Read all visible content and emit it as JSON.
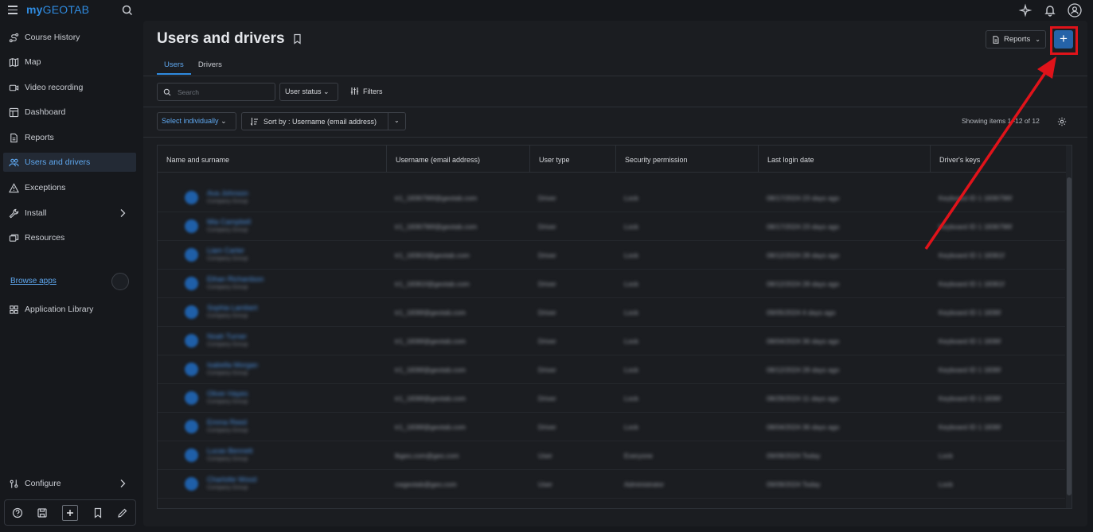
{
  "logo": {
    "part1": "my",
    "part2": "GEOTAB"
  },
  "sidebar": {
    "items": [
      {
        "label": "Course History",
        "icon": "route-icon"
      },
      {
        "label": "Map",
        "icon": "map-icon"
      },
      {
        "label": "Video recording",
        "icon": "video-icon"
      },
      {
        "label": "Dashboard",
        "icon": "dashboard-icon"
      },
      {
        "label": "Reports",
        "icon": "report-icon"
      },
      {
        "label": "Users and drivers",
        "icon": "users-icon",
        "active": true
      },
      {
        "label": "Exceptions",
        "icon": "warning-icon"
      },
      {
        "label": "Install",
        "icon": "wrench-icon"
      },
      {
        "label": "Resources",
        "icon": "resources-icon"
      }
    ],
    "browse_apps": "Browse apps",
    "app_library": "Application Library",
    "configure": "Configure"
  },
  "header": {
    "title": "Users and drivers",
    "reports_label": "Reports",
    "add_label": "+"
  },
  "tabs": [
    {
      "label": "Users",
      "active": true
    },
    {
      "label": "Drivers"
    }
  ],
  "toolbar": {
    "search_placeholder": "Search",
    "user_status": "User status",
    "filters": "Filters",
    "select_individually": "Select individually",
    "sort_by": "Sort by : Username (email address)",
    "showing": "Showing items 1–12 of 12"
  },
  "table": {
    "columns": [
      "Name and surname",
      "Username (email address)",
      "User type",
      "Security permission",
      "Last login date",
      "Driver's keys"
    ],
    "rows": [
      {
        "name": "Ava Johnson",
        "sub": "Company Group",
        "email": "tr1_1836796f@geotab.com",
        "type": "Driver",
        "perm": "Lock",
        "login": "08/17/2024 23 days ago",
        "keys": "Keyboard ID 1 1836796f"
      },
      {
        "name": "Mia Campbell",
        "sub": "Company Group",
        "email": "tr1_1836796f@geotab.com",
        "type": "Driver",
        "perm": "Lock",
        "login": "08/17/2024 23 days ago",
        "keys": "Keyboard ID 1 1836796f"
      },
      {
        "name": "Liam Carter",
        "sub": "Company Group",
        "email": "tr1_18361f@geotab.com",
        "type": "Driver",
        "perm": "Lock",
        "login": "08/12/2024 28 days ago",
        "keys": "Keyboard ID 1 18361f"
      },
      {
        "name": "Ethan Richardson",
        "sub": "Company Group",
        "email": "tr1_18361f@geotab.com",
        "type": "Driver",
        "perm": "Lock",
        "login": "08/12/2024 28 days ago",
        "keys": "Keyboard ID 1 18361f"
      },
      {
        "name": "Sophia Lambert",
        "sub": "Company Group",
        "email": "tr1_1836f@geotab.com",
        "type": "Driver",
        "perm": "Lock",
        "login": "09/05/2024 4 days ago",
        "keys": "Keyboard ID 1 1836f"
      },
      {
        "name": "Noah Turner",
        "sub": "Company Group",
        "email": "tr1_1836f@geotab.com",
        "type": "Driver",
        "perm": "Lock",
        "login": "08/04/2024 36 days ago",
        "keys": "Keyboard ID 1 1836f"
      },
      {
        "name": "Isabella Morgan",
        "sub": "Company Group",
        "email": "tr1_1836f@geotab.com",
        "type": "Driver",
        "perm": "Lock",
        "login": "08/12/2024 28 days ago",
        "keys": "Keyboard ID 1 1836f"
      },
      {
        "name": "Oliver Hayes",
        "sub": "Company Group",
        "email": "tr1_1836f@geotab.com",
        "type": "Driver",
        "perm": "Lock",
        "login": "08/29/2024 11 days ago",
        "keys": "Keyboard ID 1 1836f"
      },
      {
        "name": "Emma Reed",
        "sub": "Company Group",
        "email": "tr1_1836f@geotab.com",
        "type": "Driver",
        "perm": "Lock",
        "login": "08/04/2024 36 days ago",
        "keys": "Keyboard ID 1 1836f"
      },
      {
        "name": "Lucas Bennett",
        "sub": "Company Group",
        "email": "lbgeo.com@geo.com",
        "type": "User",
        "perm": "Everyone",
        "login": "09/09/2024 Today",
        "keys": "Lock"
      },
      {
        "name": "Charlotte Wood",
        "sub": "Company Group",
        "email": "cwgeotab@geo.com",
        "type": "User",
        "perm": "Administrator",
        "login": "09/09/2024 Today",
        "keys": "Lock"
      }
    ]
  },
  "colors": {
    "accent": "#2f8be0",
    "add_button": "#2563a8",
    "highlight": "#e0131a"
  }
}
